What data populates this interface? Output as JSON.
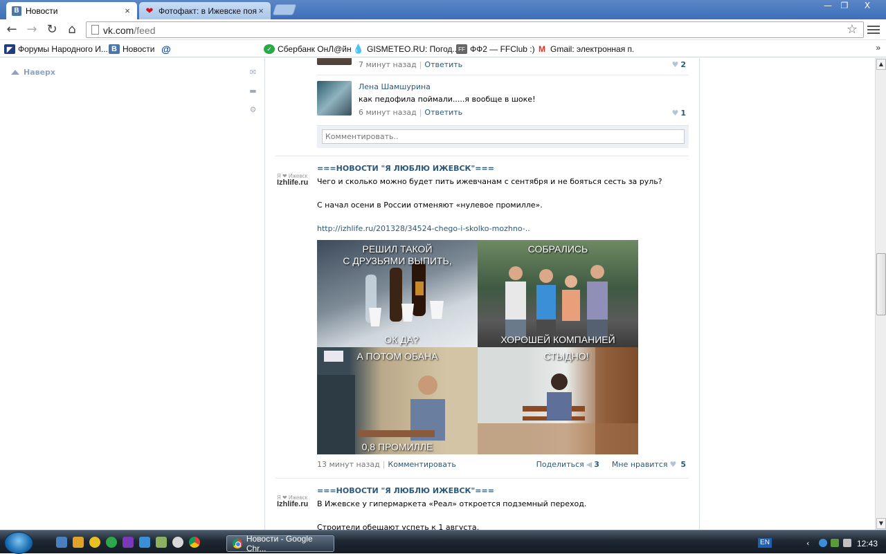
{
  "browser": {
    "tabs": [
      {
        "title": "Новости",
        "favicon": "vk-icon",
        "active": true
      },
      {
        "title": "Фотофакт: в Ижевске поя",
        "favicon": "heart-icon",
        "active": false
      }
    ],
    "tab_close": "×",
    "window_buttons": {
      "minimize": "—",
      "restore": "❐",
      "close": "X"
    },
    "url_host": "vk.com",
    "url_path": "/feed",
    "bookmarks": [
      {
        "label": "Форумы Народного И...",
        "icon": "news-icon"
      },
      {
        "label": "Новости",
        "icon": "vk-icon"
      },
      {
        "label": "",
        "icon": "mail-at-icon"
      },
      {
        "label": "Сбербанк ОнЛ@йн",
        "icon": "sberbank-icon"
      },
      {
        "label": "GISMETEO.RU: Погод...",
        "icon": "weather-drop-icon"
      },
      {
        "label": "ФФ2 — FFClub :)",
        "icon": "ffclub-icon"
      },
      {
        "label": "Gmail: электронная п...",
        "icon": "gmail-icon"
      }
    ],
    "bookmarks_more": "»",
    "vk_letter": "В"
  },
  "sidebar": {
    "to_top": "Наверх"
  },
  "comments": {
    "previous": {
      "time": "7 минут назад",
      "reply_label": "Ответить",
      "likes": "2"
    },
    "last": {
      "author": "Лена Шамшурина",
      "text": "как педофила поймали.....я вообще в шоке!",
      "time": "6 минут назад",
      "reply_label": "Ответить",
      "likes": "1"
    },
    "input_placeholder": "Комментировать.."
  },
  "posts": [
    {
      "source_logo_top": "Я ❤ Ижевск",
      "source_logo_name": "Izhlife.ru",
      "title": "===НОВОСТИ \"Я ЛЮБЛЮ ИЖЕВСК\"===",
      "line1": "Чего и сколько можно будет пить ижевчанам с сентября и не бояться сесть за руль?",
      "line2": "С начал осени в России отменяют «нулевое промилле».",
      "link": "http://izhlife.ru/201328/34524-chego-i-skolko-mozhno-..",
      "collage": {
        "tl_top": "РЕШИЛ ТАКОЙ\nС ДРУЗЬЯМИ ВЫПИТЬ,",
        "tl_bottom": "ОК ДА?",
        "tr_top": "СОБРАЛИСЬ",
        "tr_bottom": "ХОРОШЕЙ КОМПАНИЕЙ",
        "bl_top": "А ПОТОМ ОБАНА",
        "bl_bottom": "0,8 ПРОМИЛЛЕ",
        "br_top": "СТЫДНО!"
      },
      "time": "13 минут назад",
      "comment_label": "Комментировать",
      "share_label": "Поделиться",
      "shares": "3",
      "like_label": "Мне нравится",
      "likes": "5"
    },
    {
      "source_logo_top": "Я ❤ Ижевск",
      "source_logo_name": "Izhlife.ru",
      "title": "===НОВОСТИ \"Я ЛЮБЛЮ ИЖЕВСК\"===",
      "line1": "В Ижевске у гипермаркета «Реал» откроется подземный переход.",
      "line2": "Строители обещают успеть к 1 августа."
    }
  ],
  "taskbar": {
    "task_title": "Новости - Google Chr...",
    "lang": "EN",
    "clock": "12:43"
  },
  "colors": {
    "vk_blue": "#2b587a",
    "tabstrip": "#3d6fb8",
    "meta_grey": "#777777"
  }
}
